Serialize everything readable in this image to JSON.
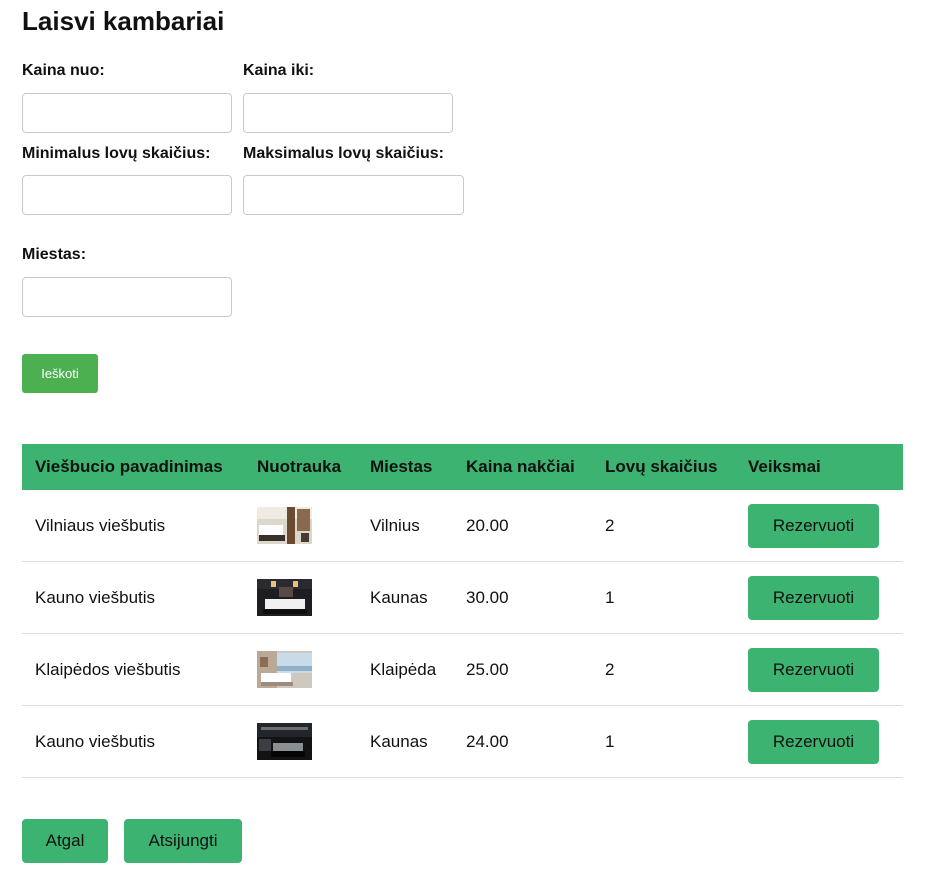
{
  "page": {
    "title": "Laisvi kambariai"
  },
  "filters": {
    "price_from_label": "Kaina nuo:",
    "price_to_label": "Kaina iki:",
    "min_beds_label": "Minimalus lovų skaičius:",
    "max_beds_label": "Maksimalus lovų skaičius:",
    "city_label": "Miestas:",
    "price_from_value": "",
    "price_to_value": "",
    "min_beds_value": "",
    "max_beds_value": "",
    "city_value": "",
    "search_label": "Ieškoti"
  },
  "table": {
    "headers": [
      "Viešbucio pavadinimas",
      "Nuotrauka",
      "Miestas",
      "Kaina nakčiai",
      "Lovų skaičius",
      "Veiksmai"
    ],
    "rows": [
      {
        "name": "Vilniaus viešbutis",
        "city": "Vilnius",
        "price": "20.00",
        "beds": "2",
        "action": "Rezervuoti",
        "photo": "bright-bedroom"
      },
      {
        "name": "Kauno viešbutis",
        "city": "Kaunas",
        "price": "30.00",
        "beds": "1",
        "action": "Rezervuoti",
        "photo": "dark-bedroom"
      },
      {
        "name": "Klaipėdos viešbutis",
        "city": "Klaipėda",
        "price": "25.00",
        "beds": "2",
        "action": "Rezervuoti",
        "photo": "seaview-bedroom"
      },
      {
        "name": "Kauno viešbutis",
        "city": "Kaunas",
        "price": "24.00",
        "beds": "1",
        "action": "Rezervuoti",
        "photo": "night-bedroom"
      }
    ]
  },
  "footer": {
    "back_label": "Atgal",
    "logout_label": "Atsijungti"
  },
  "colors": {
    "search_button": "#4caf50",
    "accent": "#3cb371",
    "row_divider": "#dcdcdc"
  }
}
